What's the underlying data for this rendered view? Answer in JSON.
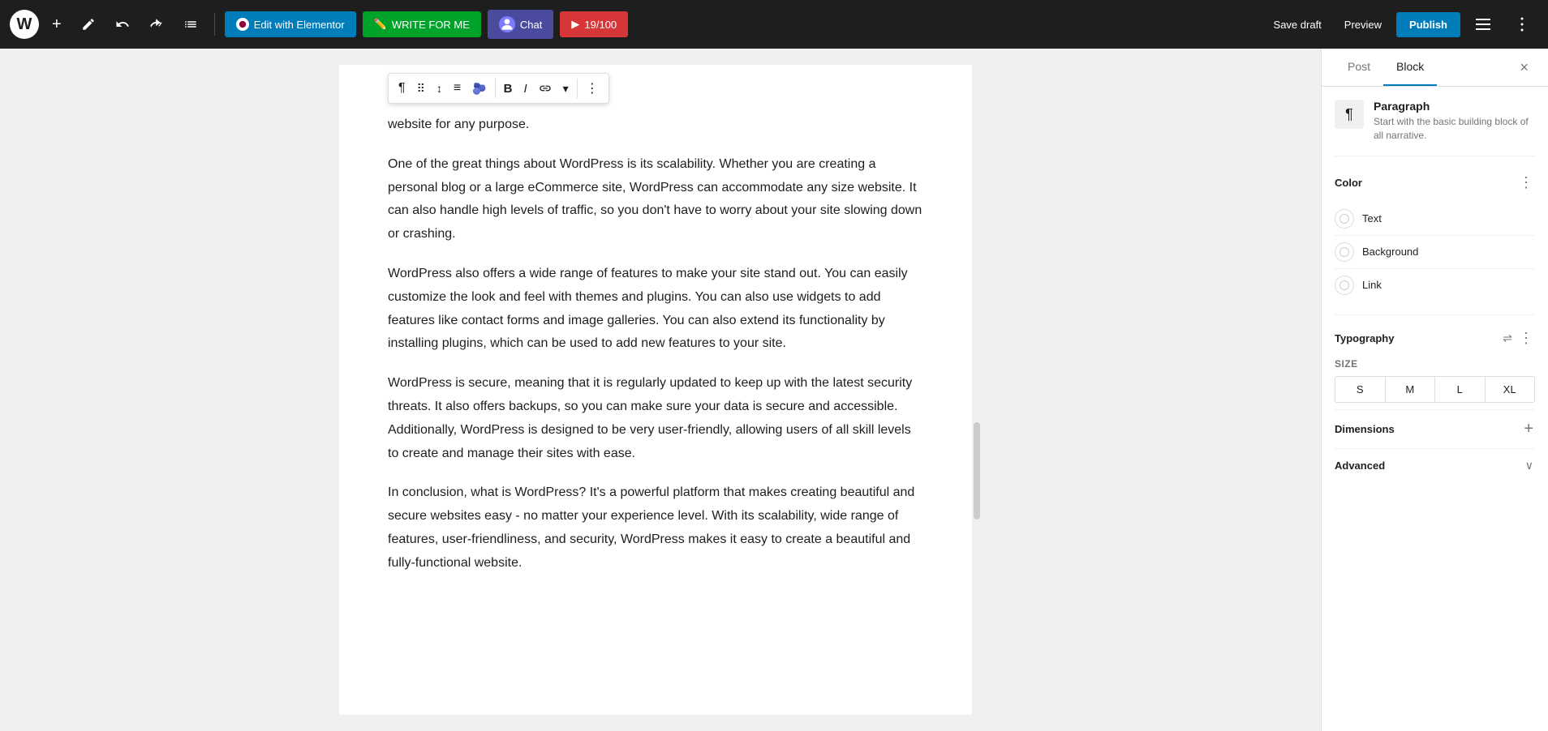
{
  "topbar": {
    "wp_logo": "W",
    "add_label": "+",
    "edit_pen_icon": "pencil",
    "undo_icon": "undo",
    "redo_icon": "redo",
    "list_view_icon": "list",
    "elementor_btn": "Edit with Elementor",
    "write_for_me_btn": "WRITE FOR ME",
    "chat_btn": "Chat",
    "score_label": "19/100",
    "save_draft_label": "Save draft",
    "preview_label": "Preview",
    "publish_label": "Publish",
    "settings_icon": "settings",
    "more_icon": "more"
  },
  "editor": {
    "content_top": "website for any purpose.",
    "paragraph1": "One of the great things about WordPress is its scalability. Whether you are creating a personal blog or a large eCommerce site, WordPress can accommodate any size website. It can also handle high levels of traffic, so you don't have to worry about your site slowing down or crashing.",
    "paragraph2": " WordPress also offers a wide range of features to make your site stand out. You can easily customize the look and feel with themes and plugins. You can also use widgets to add features like contact forms and image galleries. You can also extend its functionality by installing plugins, which can be used to add new features to your site.",
    "paragraph3": " WordPress is secure, meaning that it is regularly updated to keep up with the latest security threats. It also offers backups, so you can make sure your data is secure and accessible. Additionally, WordPress is designed to be very user-friendly, allowing users of all skill levels to create and manage their sites with ease.",
    "paragraph4": " In conclusion, what is WordPress? It's a powerful platform that makes creating beautiful and secure websites easy - no matter your experience level. With its scalability, wide range of features, user-friendliness, and security, WordPress makes it easy to create a beautiful and fully-functional website."
  },
  "block_toolbar": {
    "paragraph_icon": "¶",
    "drag_icon": "⠿",
    "arrows_icon": "↕",
    "align_icon": "≡",
    "emoji_icon": "🫐",
    "bold": "B",
    "italic": "I",
    "link": "🔗",
    "more": "⋮"
  },
  "sidebar": {
    "post_tab": "Post",
    "block_tab": "Block",
    "close_icon": "×",
    "block_type": {
      "icon": "¶",
      "title": "Paragraph",
      "description": "Start with the basic building block of all narrative."
    },
    "color": {
      "section_title": "Color",
      "more_icon": "⋮",
      "text_label": "Text",
      "background_label": "Background",
      "link_label": "Link"
    },
    "typography": {
      "section_title": "Typography",
      "more_icon": "⋮",
      "size_label": "SIZE",
      "size_options": [
        "S",
        "M",
        "L",
        "XL"
      ],
      "filter_icon": "⇌"
    },
    "dimensions": {
      "section_title": "Dimensions",
      "add_icon": "+"
    },
    "advanced": {
      "section_title": "Advanced",
      "collapse_icon": "∨"
    }
  },
  "colors": {
    "accent_blue": "#007cba",
    "publish_blue": "#007cba",
    "score_red": "#d63638"
  }
}
